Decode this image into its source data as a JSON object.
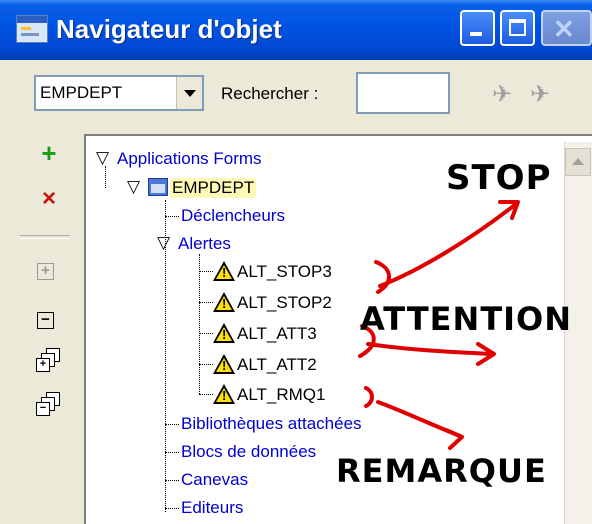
{
  "window": {
    "title": "Navigateur d'objet",
    "icon": "app-window-icon"
  },
  "toolbar": {
    "object_combo_value": "EMPDEPT",
    "search_label": "Rechercher :",
    "search_value": "",
    "find_next_icon": "find-next-icon",
    "find_previous_icon": "find-previous-icon"
  },
  "left_toolbar": {
    "create_icon": "plus-icon",
    "delete_icon": "delete-icon",
    "expand_icon": "expand-icon",
    "collapse_icon": "collapse-icon",
    "expand_all_icon": "expand-all-icon",
    "collapse_all_icon": "collapse-all-icon"
  },
  "tree": {
    "root": "Applications Forms",
    "module": "EMPDEPT",
    "declencheurs": "Déclencheurs",
    "alertes": "Alertes",
    "alert_items": [
      "ALT_STOP3",
      "ALT_STOP2",
      "ALT_ATT3",
      "ALT_ATT2",
      "ALT_RMQ1"
    ],
    "bibliotheques": "Bibliothèques attachées",
    "blocs": "Blocs de données",
    "canevas": "Canevas",
    "editeurs": "Editeurs"
  },
  "annotations": {
    "stop": "STOP",
    "attention": "ATTENTION",
    "remarque": "REMARQUE"
  },
  "colors": {
    "titlebar": "#0054e3",
    "tree_link": "#0000d0",
    "selection": "#fff9b8",
    "scribble": "#e00000"
  }
}
